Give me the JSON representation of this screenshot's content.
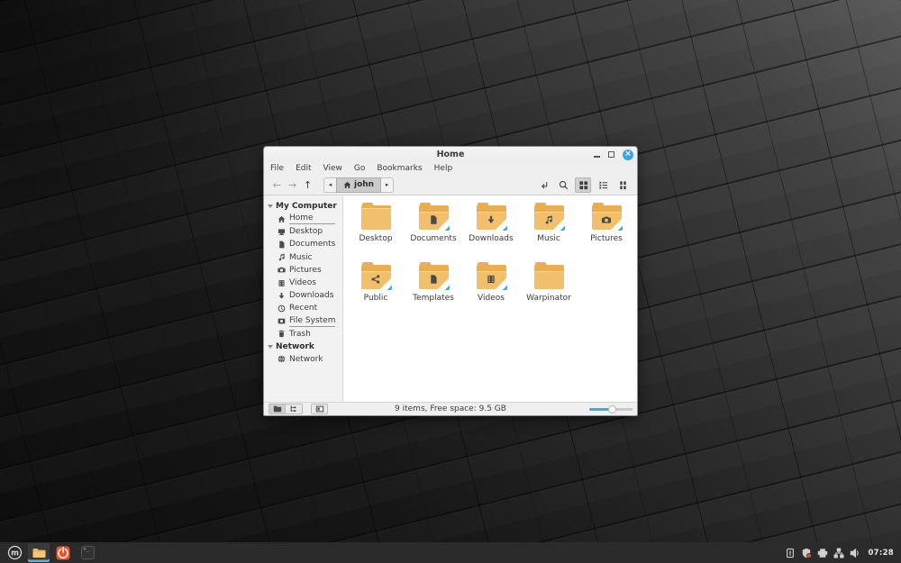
{
  "colors": {
    "accent_blue": "#3aa7e3",
    "folder_body": "#f2bf6d",
    "folder_back": "#e9ae52",
    "emblem_gray": "#4e4a45",
    "corner_stripe_teal": "#3fa9c9",
    "taskbar_bg": "#2b2b2b",
    "active_app_indicator": "#52b8d8",
    "orange_app": "#e4572e"
  },
  "window": {
    "title": "Home",
    "controls": {
      "minimize": "minimize",
      "maximize": "maximize",
      "close": "×"
    },
    "menubar": {
      "items": [
        "File",
        "Edit",
        "View",
        "Go",
        "Bookmarks",
        "Help"
      ]
    },
    "toolbar": {
      "path_segment": "john",
      "icons": [
        "back-arrow",
        "forward-arrow",
        "up-arrow",
        "breadcrumb-prev",
        "home-breadcrumb",
        "breadcrumb-next",
        "toggle-location-bar",
        "search",
        "grid-view",
        "list-view",
        "compact-view"
      ],
      "active_view": "grid-view",
      "back_glyph": "←",
      "forward_glyph": "→",
      "up_glyph": "↑"
    },
    "sidebar": {
      "sections": [
        {
          "label": "My Computer",
          "items": [
            {
              "label": "Home",
              "icon": "home-icon",
              "underlined": true
            },
            {
              "label": "Desktop",
              "icon": "desktop-icon",
              "underlined": false
            },
            {
              "label": "Documents",
              "icon": "document-icon",
              "underlined": false
            },
            {
              "label": "Music",
              "icon": "music-icon",
              "underlined": false
            },
            {
              "label": "Pictures",
              "icon": "camera-icon",
              "underlined": false
            },
            {
              "label": "Videos",
              "icon": "film-icon",
              "underlined": false
            },
            {
              "label": "Downloads",
              "icon": "download-icon",
              "underlined": false
            },
            {
              "label": "Recent",
              "icon": "clock-icon",
              "underlined": false
            },
            {
              "label": "File System",
              "icon": "disk-icon",
              "underlined": true
            },
            {
              "label": "Trash",
              "icon": "trash-icon",
              "underlined": false
            }
          ]
        },
        {
          "label": "Network",
          "items": [
            {
              "label": "Network",
              "icon": "globe-icon",
              "underlined": false
            }
          ]
        }
      ]
    },
    "files": {
      "items": [
        {
          "name": "Desktop",
          "emblem": "none"
        },
        {
          "name": "Documents",
          "emblem": "document"
        },
        {
          "name": "Downloads",
          "emblem": "download-arrow"
        },
        {
          "name": "Music",
          "emblem": "music-note"
        },
        {
          "name": "Pictures",
          "emblem": "camera"
        },
        {
          "name": "Public",
          "emblem": "share"
        },
        {
          "name": "Templates",
          "emblem": "document"
        },
        {
          "name": "Videos",
          "emblem": "film"
        },
        {
          "name": "Warpinator",
          "emblem": "none"
        }
      ]
    },
    "statusbar": {
      "status_text": "9 items, Free space: 9.5 GB",
      "zoom_level_percent": 55,
      "buttons": [
        "show-places",
        "show-treeview",
        "toggle-sidebar"
      ]
    }
  },
  "taskbar": {
    "menu": "mint-menu",
    "apps": [
      {
        "name": "file-manager",
        "active": true
      },
      {
        "name": "power-orange-app",
        "active": false
      },
      {
        "name": "terminal",
        "active": false
      }
    ],
    "terminal_glyph": ">_",
    "tray": [
      "system-report-icon",
      "update-shield-icon",
      "printer-icon",
      "network-icon",
      "volume-icon"
    ],
    "clock": "07:28"
  }
}
